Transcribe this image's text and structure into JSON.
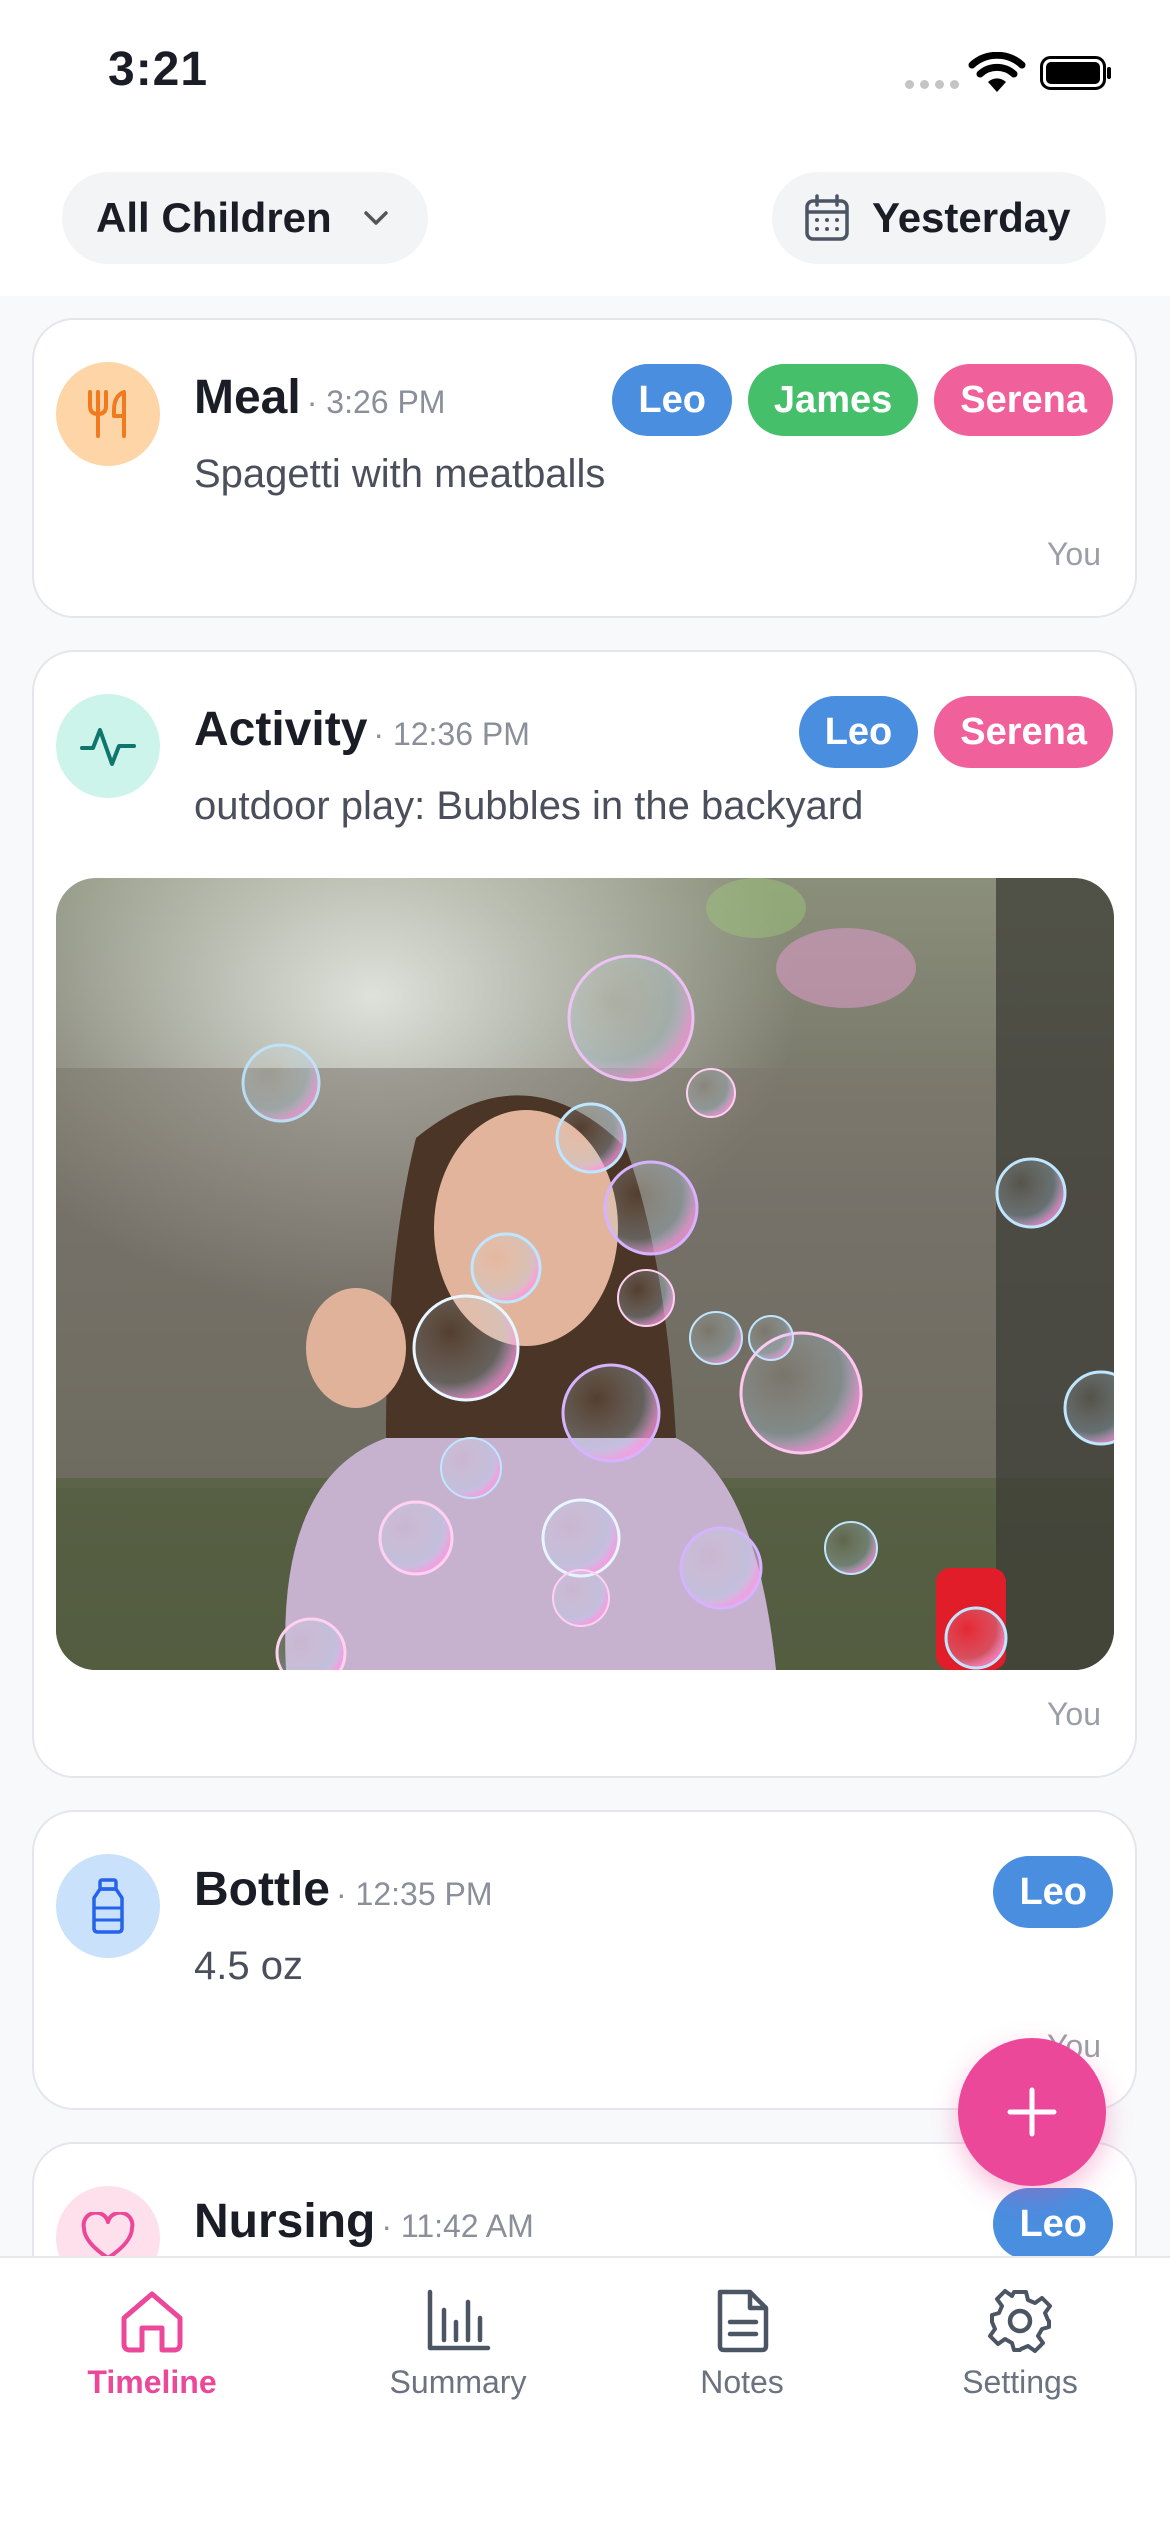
{
  "status_bar": {
    "time": "3:21"
  },
  "filters": {
    "children_label": "All Children",
    "date_label": "Yesterday"
  },
  "colors": {
    "accent": "#ec4899",
    "leo": "#4a8ee0",
    "james": "#45bf6a",
    "serena": "#f0609a"
  },
  "entries": [
    {
      "type": "Meal",
      "time": "· 3:26 PM",
      "description": "Spagetti with meatballs",
      "children": [
        "Leo",
        "James",
        "Serena"
      ],
      "logged_by": "You",
      "icon": "fork-knife-icon"
    },
    {
      "type": "Activity",
      "time": "· 12:36 PM",
      "description": "outdoor play: Bubbles in the backyard",
      "children": [
        "Leo",
        "Serena"
      ],
      "logged_by": "You",
      "icon": "activity-pulse-icon",
      "photo": "girl blowing bubbles"
    },
    {
      "type": "Bottle",
      "time": "· 12:35 PM",
      "description": "4.5 oz",
      "children": [
        "Leo"
      ],
      "logged_by": "You",
      "icon": "bottle-icon"
    },
    {
      "type": "Nursing",
      "time": "· 11:42 AM",
      "description": "",
      "children": [
        "Leo"
      ],
      "logged_by": "",
      "icon": "heart-icon"
    }
  ],
  "fab_icon": "plus-icon",
  "tabs": [
    {
      "label": "Timeline",
      "icon": "home-icon",
      "active": true
    },
    {
      "label": "Summary",
      "icon": "bar-chart-icon",
      "active": false
    },
    {
      "label": "Notes",
      "icon": "document-icon",
      "active": false
    },
    {
      "label": "Settings",
      "icon": "gear-icon",
      "active": false
    }
  ]
}
